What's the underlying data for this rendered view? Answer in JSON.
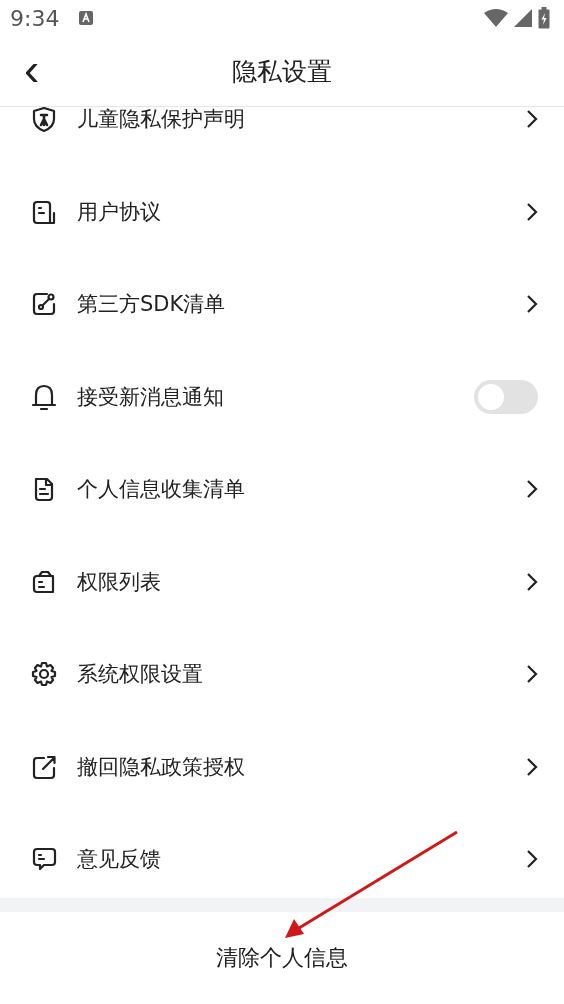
{
  "status_bar": {
    "time": "9:34"
  },
  "header": {
    "back_glyph": "‹",
    "title": "隐私设置"
  },
  "items": [
    {
      "kind": "link",
      "label": "儿童隐私保护声明"
    },
    {
      "kind": "link",
      "label": "用户协议"
    },
    {
      "kind": "link",
      "label": "第三方SDK清单"
    },
    {
      "kind": "toggle",
      "label": "接受新消息通知",
      "on": false
    },
    {
      "kind": "link",
      "label": "个人信息收集清单"
    },
    {
      "kind": "link",
      "label": "权限列表"
    },
    {
      "kind": "link",
      "label": "系统权限设置"
    },
    {
      "kind": "link",
      "label": "撤回隐私政策授权"
    },
    {
      "kind": "link",
      "label": "意见反馈"
    }
  ],
  "bottom_button": {
    "label": "清除个人信息"
  }
}
